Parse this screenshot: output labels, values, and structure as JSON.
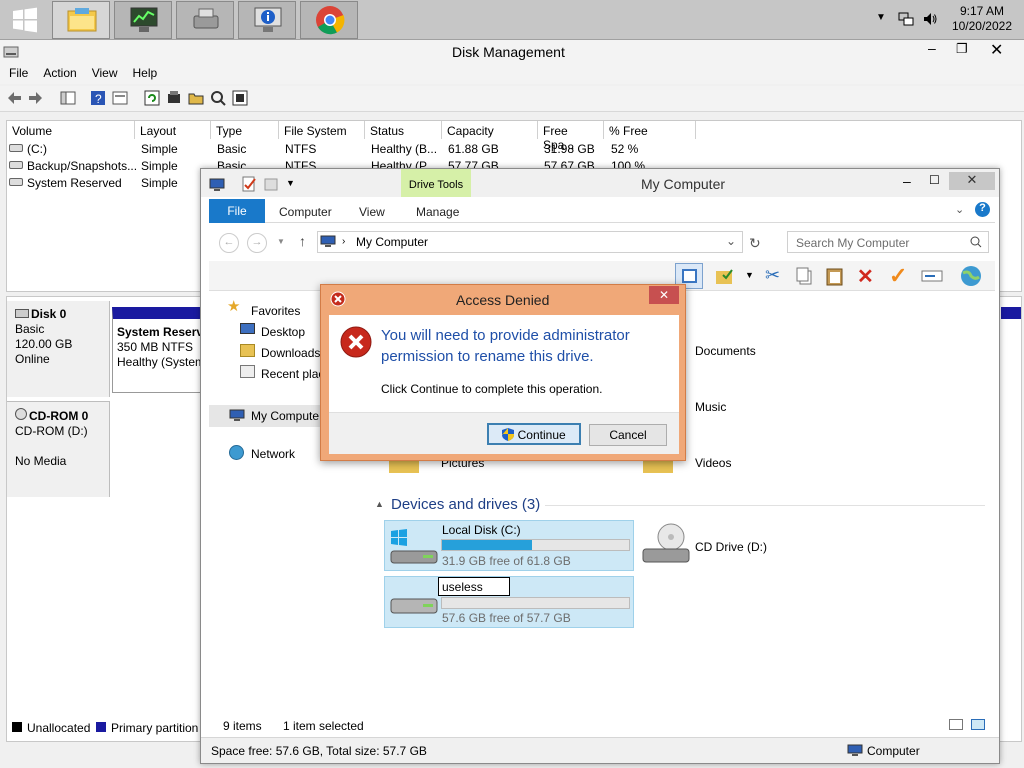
{
  "taskbar": {
    "clock_time": "9:17 AM",
    "clock_date": "10/20/2022",
    "start_icon": "windows-logo",
    "pinned": [
      "file-explorer",
      "server-manager",
      "drive-tool",
      "information",
      "chrome"
    ]
  },
  "disk_mgmt": {
    "title": "Disk Management",
    "menu": [
      "File",
      "Action",
      "View",
      "Help"
    ],
    "columns": [
      "Volume",
      "Layout",
      "Type",
      "File System",
      "Status",
      "Capacity",
      "Free Spa...",
      "% Free"
    ],
    "volumes": [
      {
        "volume": "(C:)",
        "layout": "Simple",
        "type": "Basic",
        "fs": "NTFS",
        "status": "Healthy (B...",
        "capacity": "61.88 GB",
        "free": "31.98 GB",
        "pct": "52 %"
      },
      {
        "volume": "Backup/Snapshots...",
        "layout": "Simple",
        "type": "Basic",
        "fs": "NTFS",
        "status": "Healthy (P...",
        "capacity": "57.77 GB",
        "free": "57.67 GB",
        "pct": "100 %"
      },
      {
        "volume": "System Reserved",
        "layout": "Simple",
        "type": "",
        "fs": "",
        "status": "",
        "capacity": "",
        "free": "",
        "pct": ""
      }
    ],
    "disk0": {
      "name": "Disk 0",
      "type": "Basic",
      "size": "120.00 GB",
      "state": "Online"
    },
    "partition0": {
      "name": "System Reserv",
      "size": "350 MB NTFS",
      "status": "Healthy (System"
    },
    "cdrom": {
      "name": "CD-ROM 0",
      "drive": "CD-ROM (D:)",
      "state": "No Media"
    },
    "legend": {
      "unallocated": "Unallocated",
      "primary": "Primary partition"
    },
    "colors": {
      "primary": "#1a1aa0",
      "unallocated": "#000000"
    }
  },
  "explorer": {
    "title": "My Computer",
    "context_tab": "Drive Tools",
    "tabs": {
      "file": "File",
      "computer": "Computer",
      "view": "View",
      "manage": "Manage"
    },
    "address": "My Computer",
    "search_placeholder": "Search My Computer",
    "nav": {
      "favorites": "Favorites",
      "desktop": "Desktop",
      "downloads": "Downloads",
      "recent": "Recent plac",
      "computer": "My Compute",
      "network": "Network"
    },
    "folders": {
      "documents": "Documents",
      "music": "Music",
      "pictures": "Pictures",
      "videos": "Videos"
    },
    "devices_header": "Devices and drives (3)",
    "drives": [
      {
        "name": "Local Disk (C:)",
        "free_text": "31.9 GB free of 61.8 GB",
        "used_fraction": 0.48
      },
      {
        "name": "useless",
        "free_text": "57.6 GB free of 57.7 GB",
        "used_fraction": 0.0
      },
      {
        "name": "CD Drive (D:)"
      }
    ],
    "status_items": "9 items",
    "status_selected": "1 item selected",
    "status_space": "Space free: 57.6 GB, Total size: 57.7 GB",
    "status_location": "Computer",
    "accent": "#1979ca"
  },
  "dialog": {
    "title": "Access Denied",
    "main": "You will need to provide administrator permission to rename this drive.",
    "sub": "Click Continue to complete this operation.",
    "continue": "Continue",
    "cancel": "Cancel",
    "main_color": "#1f4fa8"
  }
}
